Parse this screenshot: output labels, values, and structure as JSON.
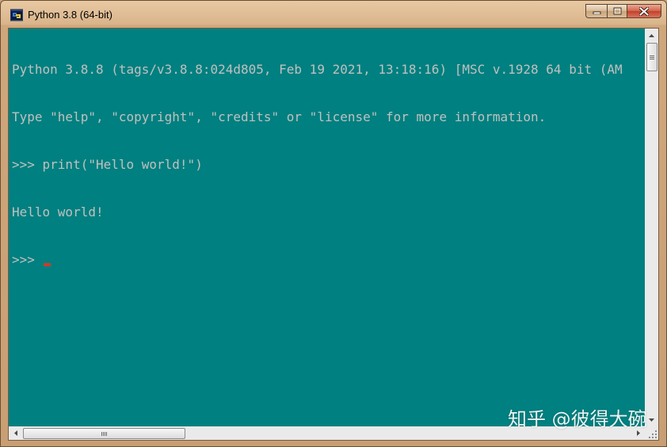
{
  "window": {
    "title": "Python 3.8 (64-bit)",
    "app_icon": "python-icon"
  },
  "caption_buttons": {
    "minimize_icon": "minimize-icon",
    "maximize_icon": "maximize-icon",
    "close_icon": "close-icon"
  },
  "console": {
    "lines": [
      "Python 3.8.8 (tags/v3.8.8:024d805, Feb 19 2021, 13:18:16) [MSC v.1928 64 bit (AM",
      "Type \"help\", \"copyright\", \"credits\" or \"license\" for more information.",
      ">>> print(\"Hello world!\")",
      "Hello world!",
      ">>> "
    ],
    "text_color": "#c0c0c0",
    "background_color": "#008080",
    "cursor_color": "#d03a2a"
  },
  "watermark": {
    "text": "知乎 @彼得大碗"
  }
}
